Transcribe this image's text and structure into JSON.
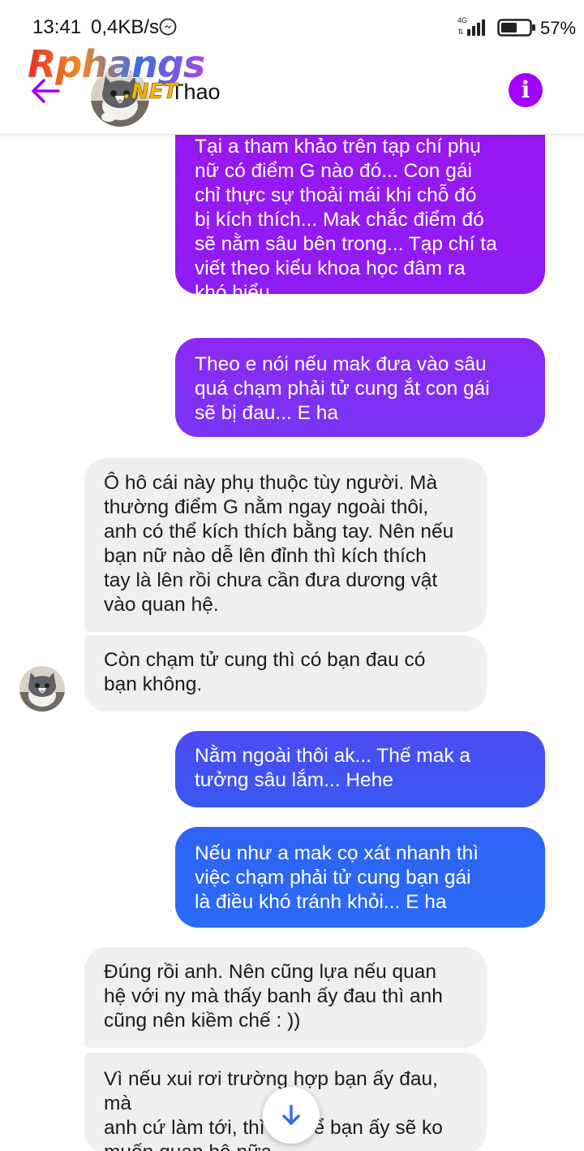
{
  "status_bar": {
    "time": "13:41",
    "speed": "0,4KB/s",
    "network": "4G",
    "battery": "57%",
    "battery_level": 0.57
  },
  "header": {
    "contact_name": "Thao",
    "back_icon": "arrow-left-icon",
    "info_icon": "info-icon"
  },
  "watermark": {
    "main": "Rphangs",
    "suffix": ".NET"
  },
  "colors": {
    "accent": "#a200ff",
    "out_bubble_top": "#9a17f0",
    "out_bubble_bottom": "#2a6af5",
    "in_bubble": "#efefef"
  },
  "messages": [
    {
      "direction": "out",
      "text": "Tại  a tham khảo trên tạp chí  phụ\nnữ  có  điểm G nào  đó... Con gái\nchỉ  thực sự  thoải mái khi chỗ  đó\nbị  kích thích... Mak chắc  điểm  đó\nsẽ  nằm  sâu bên trong... Tạp chí  ta\nviết  theo kiểu  khoa học  đâm ra\nkhó  hiểu"
    },
    {
      "direction": "out",
      "text": "Theo e nói  nếu  mak đưa  vào  sâu\nquá  chạm phải  tử cung  ắt  con gái\nsẽ  bị đau... E ha"
    },
    {
      "direction": "in",
      "text": "Ô hô cái này phụ thuộc tùy người. Mà\nthường điểm G nằm ngay ngoài thôi,\nanh có thể kích thích bằng tay. Nên nếu\nbạn nữ nào dễ lên đỉnh thì kích thích\ntay là lên rồi chưa cần đưa dương vật\nvào quan hệ."
    },
    {
      "direction": "in",
      "text": "Còn chạm tử cung thì có bạn đau có\nbạn không."
    },
    {
      "direction": "out",
      "text": "Nằm  ngoài  thôi  ak... Thế  mak a\ntưởng  sâu lắm... Hehe"
    },
    {
      "direction": "out",
      "text": "Nếu  như  a mak cọ xát  nhanh thì\nviệc  chạm phải  tử cung  bạn  gái\nlà  điều  khó  tránh  khỏi... E ha"
    },
    {
      "direction": "in",
      "text": "Đúng rồi anh. Nên cũng lựa nếu quan\nhệ với ny mà thấy banh ấy đau thì anh\ncũng nên kiềm chế : ))"
    },
    {
      "direction": "in",
      "text": "Vì nếu xui rơi trường hợp bạn ấy đau, mà\nanh cứ làm tới, thì có thể bạn ấy sẽ ko\nmuốn quan hệ nữa."
    }
  ],
  "scroll_down_icon": "arrow-down-icon"
}
